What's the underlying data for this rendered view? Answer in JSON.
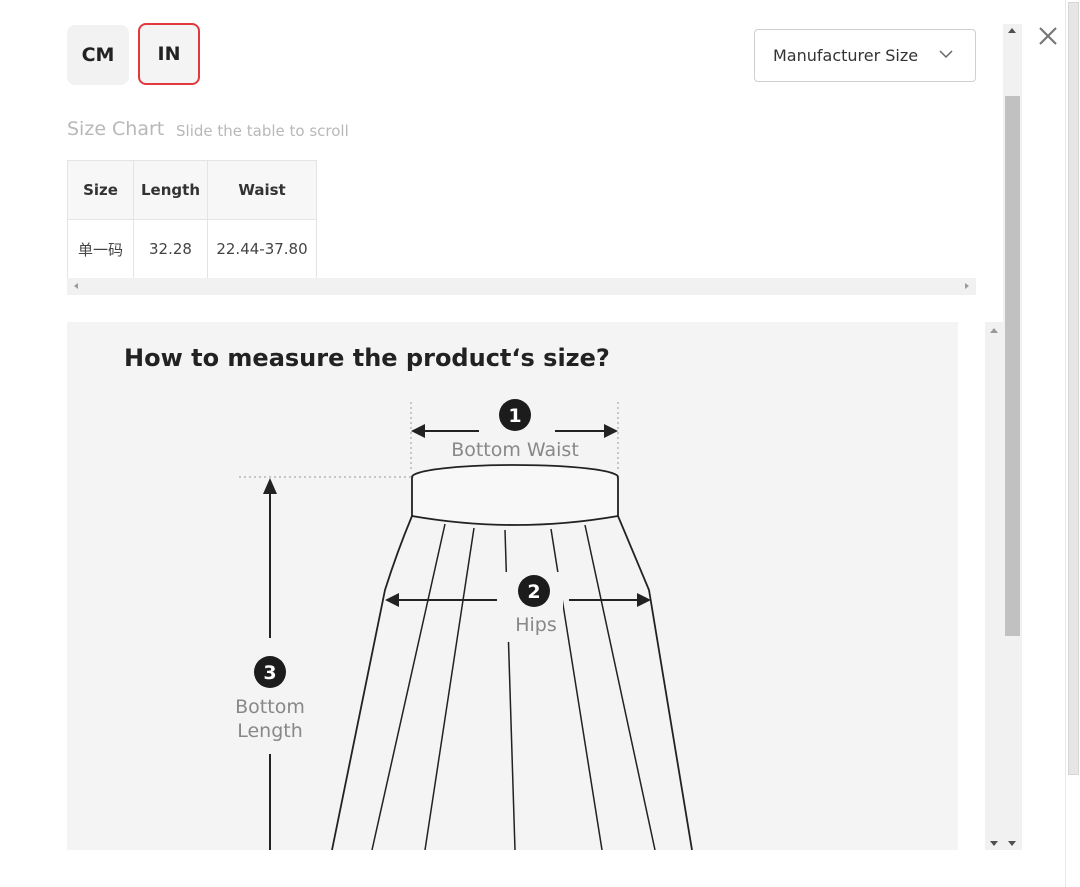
{
  "units": {
    "cm_label": "CM",
    "in_label": "IN",
    "selected": "IN",
    "selected_border_color": "#e0393e"
  },
  "size_select": {
    "value": "Manufacturer Size",
    "icon": "chevron-down-icon"
  },
  "close": {
    "icon": "close-icon"
  },
  "size_chart": {
    "title": "Size Chart",
    "hint": "Slide the table to scroll",
    "columns": [
      "Size",
      "Length",
      "Waist"
    ],
    "rows": [
      [
        "单一码",
        "32.28",
        "22.44-37.80"
      ]
    ]
  },
  "measure": {
    "title": "How to measure the product‘s size?",
    "markers": [
      {
        "number": "1",
        "label": "Bottom Waist"
      },
      {
        "number": "2",
        "label": "Hips"
      },
      {
        "number": "3",
        "label_line1": "Bottom",
        "label_line2": "Length"
      }
    ]
  }
}
